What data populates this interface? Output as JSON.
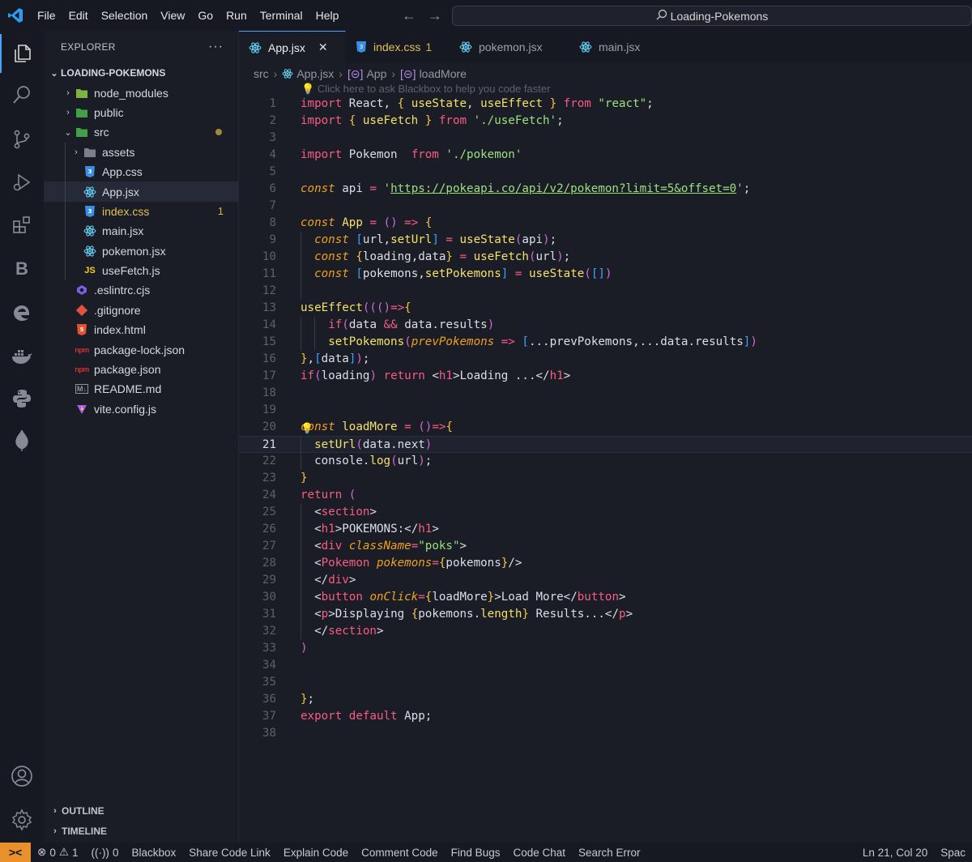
{
  "titlebar": {
    "menu": [
      "File",
      "Edit",
      "Selection",
      "View",
      "Go",
      "Run",
      "Terminal",
      "Help"
    ],
    "command_center": "Loading-Pokemons"
  },
  "activity_icons": [
    "explorer-icon",
    "search-icon",
    "source-control-icon",
    "run-debug-icon",
    "extensions-icon",
    "blackbox-icon",
    "edge-icon",
    "docker-icon",
    "python-icon",
    "mongodb-icon",
    "account-icon",
    "settings-gear-icon"
  ],
  "sidebar": {
    "title": "EXPLORER",
    "more": "···",
    "project": "LOADING-POKEMONS",
    "tree": [
      {
        "label": "node_modules",
        "chevron": "›",
        "icon": "folder-node",
        "depth": 1
      },
      {
        "label": "public",
        "chevron": "›",
        "icon": "folder-public",
        "depth": 1
      },
      {
        "label": "src",
        "chevron": "⌄",
        "icon": "folder-src",
        "depth": 1,
        "dot": true
      },
      {
        "label": "assets",
        "chevron": "›",
        "icon": "folder-assets",
        "depth": 2
      },
      {
        "label": "App.css",
        "icon": "css",
        "depth": 2
      },
      {
        "label": "App.jsx",
        "icon": "react",
        "depth": 2,
        "selected": true
      },
      {
        "label": "index.css",
        "icon": "css",
        "depth": 2,
        "warn": "1"
      },
      {
        "label": "main.jsx",
        "icon": "react",
        "depth": 2
      },
      {
        "label": "pokemon.jsx",
        "icon": "react",
        "depth": 2
      },
      {
        "label": "useFetch.js",
        "icon": "js",
        "depth": 2
      },
      {
        "label": ".eslintrc.cjs",
        "icon": "eslint",
        "depth": 1
      },
      {
        "label": ".gitignore",
        "icon": "git",
        "depth": 1
      },
      {
        "label": "index.html",
        "icon": "html",
        "depth": 1
      },
      {
        "label": "package-lock.json",
        "icon": "npm",
        "depth": 1
      },
      {
        "label": "package.json",
        "icon": "npm",
        "depth": 1
      },
      {
        "label": "README.md",
        "icon": "md",
        "depth": 1
      },
      {
        "label": "vite.config.js",
        "icon": "vite",
        "depth": 1
      }
    ],
    "outline": "OUTLINE",
    "timeline": "TIMELINE"
  },
  "tabs": [
    {
      "label": "App.jsx",
      "icon": "react",
      "active": true,
      "close": "✕"
    },
    {
      "label": "index.css",
      "icon": "css",
      "warn": "1"
    },
    {
      "label": "pokemon.jsx",
      "icon": "react"
    },
    {
      "label": "main.jsx",
      "icon": "react"
    }
  ],
  "breadcrumb": {
    "folder": "src",
    "file": "App.jsx",
    "symbol1": "App",
    "symbol2": "loadMore"
  },
  "hint": "Click here to ask Blackbox to help you code faster",
  "editor": {
    "current_line": 21,
    "lines": [
      "import React, { useState, useEffect } from \"react\";",
      "import { useFetch } from './useFetch';",
      "",
      "import Pokemon  from './pokemon'",
      "",
      "const api = 'https://pokeapi.co/api/v2/pokemon?limit=5&offset=0';",
      "",
      "const App = () => {",
      "  const [url,setUrl] = useState(api);",
      "  const {loading,data} = useFetch(url);",
      "  const [pokemons,setPokemons] = useState([])",
      "",
      "useEffect((()=>{",
      "    if(data && data.results)",
      "    setPokemons(prevPokemons => [...prevPokemons,...data.results])",
      "},[data]);",
      "if(loading) return <h1>Loading ...</h1>",
      "",
      "",
      "const loadMore = ()=>{",
      "  setUrl(data.next)",
      "  console.log(url);",
      "}",
      "return (",
      "  <section>",
      "  <h1>POKEMONS:</h1>",
      "  <div className=\"poks\">",
      "  <Pokemon pokemons={pokemons}/>",
      "  </div>",
      "  <button onClick={loadMore}>Load More</button>",
      "  <p>Displaying {pokemons.length} Results...</p>",
      "  </section>",
      ")",
      "",
      "",
      "};",
      "export default App;",
      ""
    ]
  },
  "statusbar": {
    "remote": "><",
    "errors": "0",
    "warnings": "1",
    "ports": "0",
    "items": [
      "Blackbox",
      "Share Code Link",
      "Explain Code",
      "Comment Code",
      "Find Bugs",
      "Code Chat",
      "Search Error"
    ],
    "position": "Ln 21, Col 20",
    "spaces": "Spac"
  }
}
